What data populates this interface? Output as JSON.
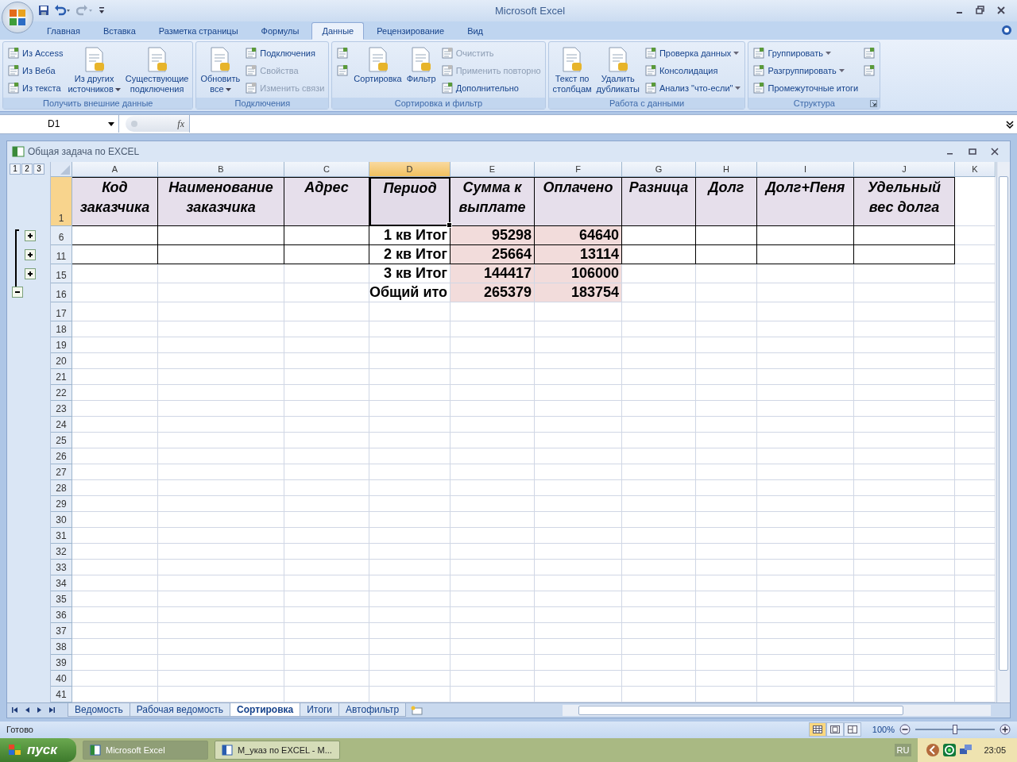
{
  "app": {
    "title": "Microsoft Excel"
  },
  "ribbon": {
    "tabs": [
      {
        "label": "Главная",
        "selected": false
      },
      {
        "label": "Вставка",
        "selected": false
      },
      {
        "label": "Разметка страницы",
        "selected": false
      },
      {
        "label": "Формулы",
        "selected": false
      },
      {
        "label": "Данные",
        "selected": true
      },
      {
        "label": "Рецензирование",
        "selected": false
      },
      {
        "label": "Вид",
        "selected": false
      }
    ],
    "groups": [
      {
        "title": "Получить внешние данные",
        "launcher": false,
        "items": [
          {
            "kind": "small",
            "label": "Из Access",
            "disabled": false,
            "dropdown": false
          },
          {
            "kind": "small",
            "label": "Из Веба",
            "disabled": false,
            "dropdown": false
          },
          {
            "kind": "small",
            "label": "Из текста",
            "disabled": false,
            "dropdown": false
          },
          {
            "kind": "large",
            "label": "Из других\nисточников",
            "disabled": false,
            "dropdown": true
          },
          {
            "kind": "large",
            "label": "Существующие\nподключения",
            "disabled": false,
            "dropdown": false
          }
        ]
      },
      {
        "title": "Подключения",
        "launcher": false,
        "items": [
          {
            "kind": "large",
            "label": "Обновить\nвсе",
            "disabled": false,
            "dropdown": true
          },
          {
            "kind": "small",
            "label": "Подключения",
            "disabled": false,
            "dropdown": false
          },
          {
            "kind": "small",
            "label": "Свойства",
            "disabled": true,
            "dropdown": false
          },
          {
            "kind": "small",
            "label": "Изменить связи",
            "disabled": true,
            "dropdown": false
          }
        ]
      },
      {
        "title": "Сортировка и фильтр",
        "launcher": false,
        "items": [
          {
            "kind": "small",
            "disabled": false,
            "dropdown": false
          },
          {
            "kind": "small",
            "disabled": false,
            "dropdown": false
          },
          {
            "kind": "large",
            "label": "Сортировка",
            "disabled": false,
            "dropdown": false
          },
          {
            "kind": "large",
            "label": "Фильтр",
            "disabled": false,
            "dropdown": false
          },
          {
            "kind": "small",
            "label": "Очистить",
            "disabled": true,
            "dropdown": false
          },
          {
            "kind": "small",
            "label": "Применить повторно",
            "disabled": true,
            "dropdown": false
          },
          {
            "kind": "small",
            "label": "Дополнительно",
            "disabled": false,
            "dropdown": false
          }
        ]
      },
      {
        "title": "Работа с данными",
        "launcher": false,
        "items": [
          {
            "kind": "large",
            "label": "Текст по\nстолбцам",
            "disabled": false,
            "dropdown": false
          },
          {
            "kind": "large",
            "label": "Удалить\nдубликаты",
            "disabled": false,
            "dropdown": false
          },
          {
            "kind": "small",
            "label": "Проверка данных",
            "disabled": false,
            "dropdown": true
          },
          {
            "kind": "small",
            "label": "Консолидация",
            "disabled": false,
            "dropdown": false
          },
          {
            "kind": "small",
            "label": "Анализ \"что-если\"",
            "disabled": false,
            "dropdown": true
          }
        ]
      },
      {
        "title": "Структура",
        "launcher": true,
        "items": [
          {
            "kind": "small",
            "label": "Группировать",
            "disabled": false,
            "dropdown": true
          },
          {
            "kind": "small",
            "label": "Разгруппировать",
            "disabled": false,
            "dropdown": true
          },
          {
            "kind": "small",
            "label": "Промежуточные итоги",
            "disabled": false,
            "dropdown": false
          },
          {
            "kind": "small",
            "disabled": false,
            "dropdown": false
          },
          {
            "kind": "small",
            "disabled": false,
            "dropdown": false
          }
        ]
      }
    ]
  },
  "formula_bar": {
    "name_box": "D1",
    "function_label": "fx"
  },
  "workbook": {
    "title": "Общая задача по EXCEL",
    "outline_levels": [
      "1",
      "2",
      "3"
    ],
    "columns": [
      {
        "label": "A",
        "selected": false
      },
      {
        "label": "B",
        "selected": false
      },
      {
        "label": "C",
        "selected": false
      },
      {
        "label": "D",
        "selected": true
      },
      {
        "label": "E",
        "selected": false
      },
      {
        "label": "F",
        "selected": false
      },
      {
        "label": "G",
        "selected": false
      },
      {
        "label": "H",
        "selected": false
      },
      {
        "label": "I",
        "selected": false
      },
      {
        "label": "J",
        "selected": false
      },
      {
        "label": "K",
        "selected": false
      }
    ],
    "header_row": {
      "number": "1",
      "selected": true,
      "cells": [
        {
          "text": "Код заказчика",
          "selected": false
        },
        {
          "text": "Наименование заказчика",
          "selected": false
        },
        {
          "text": "Адрес",
          "selected": false
        },
        {
          "text": "Период",
          "selected": true
        },
        {
          "text": "Сумма к выплате",
          "selected": false
        },
        {
          "text": "Оплачено",
          "selected": false
        },
        {
          "text": "Разница",
          "selected": false
        },
        {
          "text": "Долг",
          "selected": false
        },
        {
          "text": "Долг+Пеня",
          "selected": false
        },
        {
          "text": "Удельный вес долга",
          "selected": false
        }
      ]
    },
    "rows": [
      {
        "number": "6",
        "period": "1 кв Итог",
        "sum": "95298",
        "paid": "64640",
        "bordered": true,
        "collapsed": true
      },
      {
        "number": "11",
        "period": "2 кв Итог",
        "sum": "25664",
        "paid": "13114",
        "bordered": true,
        "collapsed": true
      },
      {
        "number": "15",
        "period": "3 кв Итог",
        "sum": "144417",
        "paid": "106000",
        "bordered": false,
        "collapsed": true
      },
      {
        "number": "16",
        "period": "Общий ито",
        "sum": "265379",
        "paid": "183754",
        "bordered": false,
        "collapsed": false
      }
    ],
    "empty_rows": [
      "17",
      "18",
      "19",
      "20",
      "21",
      "22",
      "23",
      "24",
      "25",
      "26",
      "27",
      "28",
      "29",
      "30",
      "31",
      "32",
      "33",
      "34",
      "35",
      "36",
      "37",
      "38",
      "39",
      "40",
      "41"
    ],
    "sheets": [
      {
        "label": "Ведомость",
        "selected": false
      },
      {
        "label": "Рабочая ведомость",
        "selected": false
      },
      {
        "label": "Сортировка",
        "selected": true
      },
      {
        "label": "Итоги",
        "selected": false
      },
      {
        "label": "Автофильтр",
        "selected": false
      }
    ]
  },
  "status_bar": {
    "text": "Готово",
    "views": [
      {
        "selected": true
      },
      {
        "selected": false
      },
      {
        "selected": false
      }
    ],
    "zoom": "100%",
    "zoom_slider": {
      "level": 0.5
    }
  },
  "taskbar": {
    "start": "пуск",
    "tasks": [
      {
        "label": "Microsoft Excel",
        "selected": true
      },
      {
        "label": "М_указ по EXCEL - М...",
        "selected": false
      }
    ],
    "language": "RU",
    "clock": "23:05"
  }
}
